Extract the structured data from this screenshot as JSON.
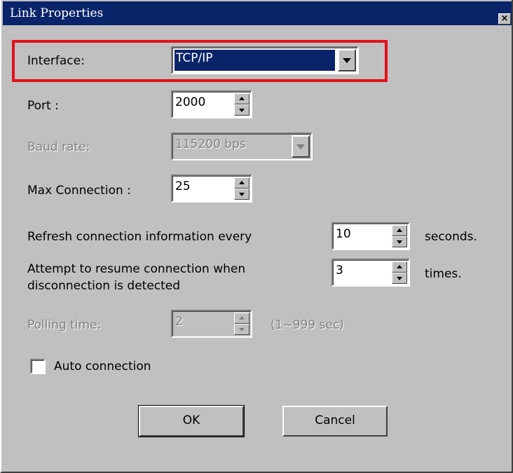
{
  "window": {
    "title": "Link Properties",
    "close_glyph": "×"
  },
  "interface": {
    "label": "Interface:",
    "value": "TCP/IP"
  },
  "port": {
    "label": "Port :",
    "value": "2000"
  },
  "baud_rate": {
    "label": "Baud rate:",
    "value": "115200 bps",
    "enabled": false
  },
  "max_connection": {
    "label": "Max Connection :",
    "value": "25"
  },
  "refresh": {
    "label": "Refresh connection information every",
    "value": "10",
    "unit": "seconds."
  },
  "resume": {
    "label_line1": "Attempt to resume connection when",
    "label_line2": "disconnection is detected",
    "value": "3",
    "unit": "times."
  },
  "polling": {
    "label": "Polling time:",
    "value": "2",
    "range": "(1~999 sec)",
    "enabled": false
  },
  "auto_connection": {
    "label": "Auto connection",
    "checked": false
  },
  "buttons": {
    "ok": "OK",
    "cancel": "Cancel"
  },
  "colors": {
    "titlebar": "#0a246a",
    "dialog_bg": "#c0c0c0",
    "highlight_box": "#e4101b",
    "disabled_text": "#808080"
  }
}
